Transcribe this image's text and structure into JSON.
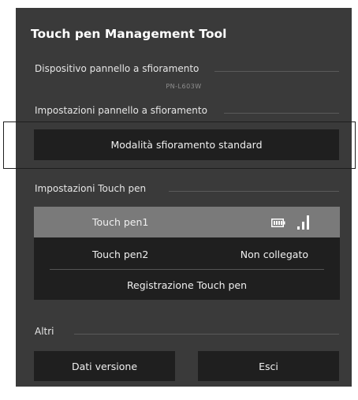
{
  "window": {
    "title": "Touch pen Management Tool"
  },
  "device_section": {
    "label": "Dispositivo pannello a sfioramento",
    "device_name": "PN-L603W"
  },
  "panel_settings": {
    "label": "Impostazioni pannello a sfioramento",
    "mode_button_label": "Modalità sfioramento standard"
  },
  "pen_settings": {
    "label": "Impostazioni Touch pen",
    "pens": [
      {
        "name": "Touch pen1",
        "status": "",
        "battery_icon": "battery-icon",
        "signal_icon": "signal-strength-icon",
        "signal_level": 3
      },
      {
        "name": "Touch pen2",
        "status": "Non collegato"
      }
    ],
    "register_label": "Registrazione Touch pen"
  },
  "others": {
    "label": "Altri",
    "version_button_label": "Dati versione",
    "exit_button_label": "Esci"
  },
  "colors": {
    "panel_background": "#3a3a3a",
    "button_background": "#1f1f1f",
    "selected_row": "#7a7a7a"
  }
}
